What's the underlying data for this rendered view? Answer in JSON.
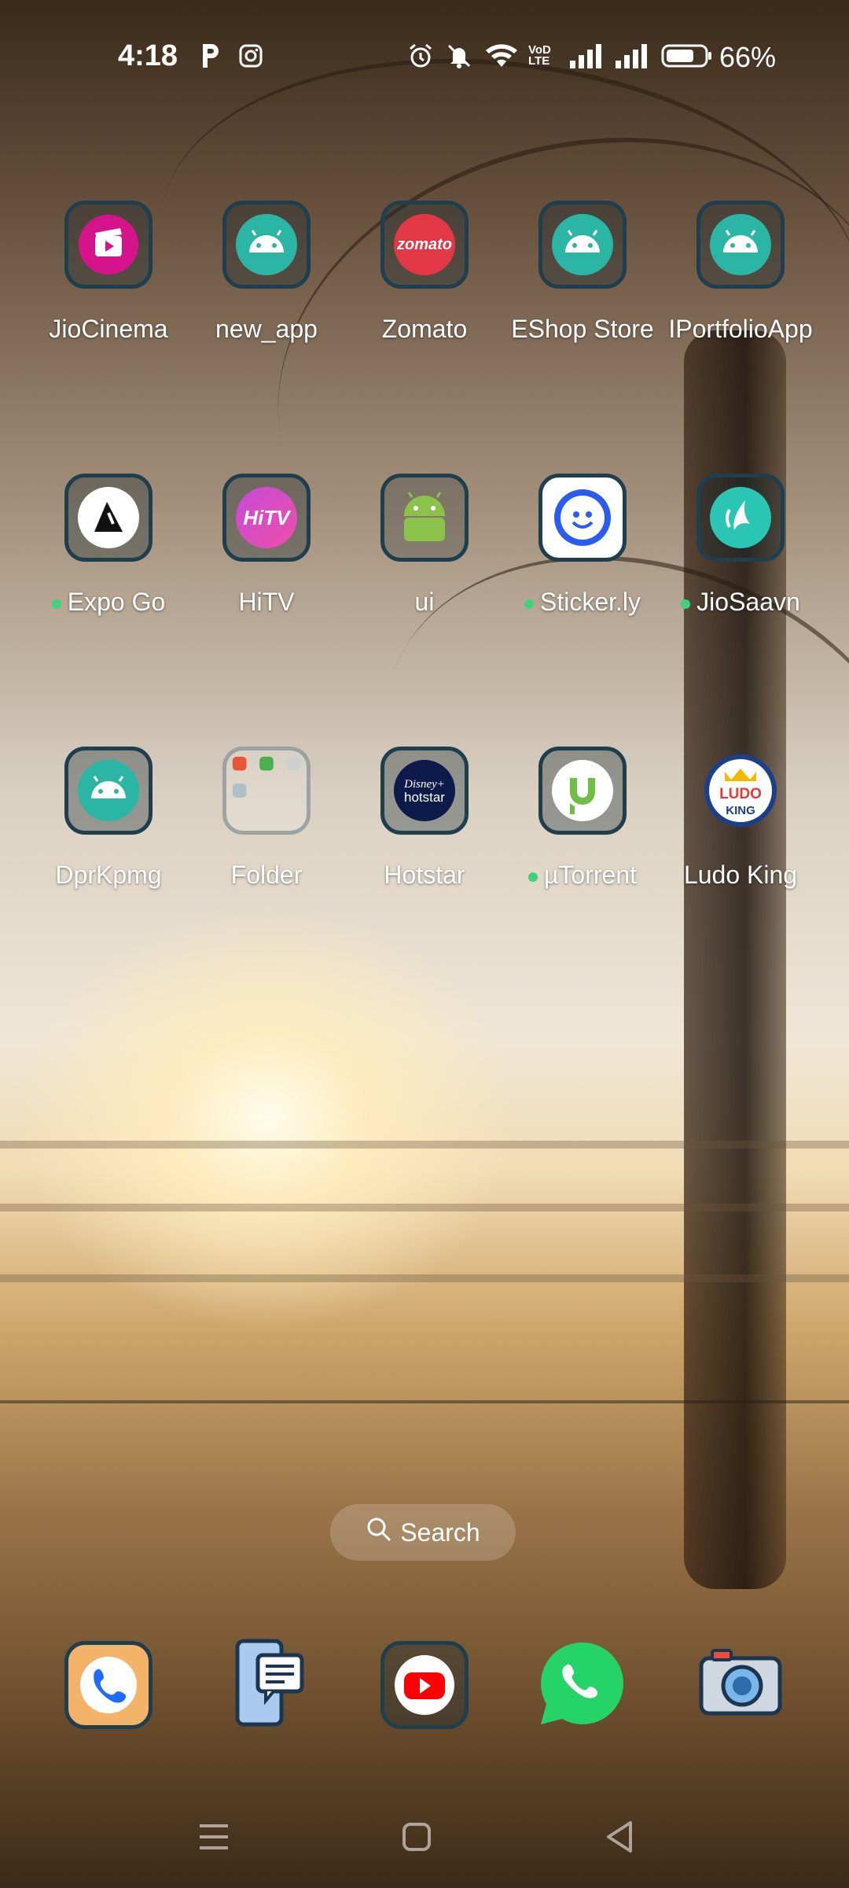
{
  "status_bar": {
    "time": "4:18",
    "battery_percent": "66%",
    "network_label": "VoD LTE",
    "icons": [
      "p-notification-icon",
      "instagram-icon",
      "alarm-icon",
      "mute-icon",
      "wifi-icon",
      "volte-icon",
      "signal-icon",
      "signal-icon",
      "battery-icon"
    ]
  },
  "apps": [
    {
      "label": "JioCinema",
      "icon": "jiocinema-icon",
      "dot": false
    },
    {
      "label": "new_app",
      "icon": "android-icon",
      "dot": false
    },
    {
      "label": "Zomato",
      "icon": "zomato-icon",
      "dot": false
    },
    {
      "label": "EShop Store",
      "icon": "android-icon",
      "dot": false
    },
    {
      "label": "IPortfolioApp",
      "icon": "android-icon",
      "dot": false
    },
    {
      "label": "Expo Go",
      "icon": "expo-go-icon",
      "dot": true
    },
    {
      "label": "HiTV",
      "icon": "hitv-icon",
      "dot": false
    },
    {
      "label": "ui",
      "icon": "android-green-icon",
      "dot": false
    },
    {
      "label": "Sticker.ly",
      "icon": "stickerly-icon",
      "dot": true
    },
    {
      "label": "JioSaavn",
      "icon": "jiosaavn-icon",
      "dot": true
    },
    {
      "label": "DprKpmg",
      "icon": "android-icon",
      "dot": false
    },
    {
      "label": "Folder",
      "icon": "folder-icon",
      "dot": false
    },
    {
      "label": "Hotstar",
      "icon": "hotstar-icon",
      "dot": false
    },
    {
      "label": "µTorrent",
      "icon": "utorrent-icon",
      "dot": true
    },
    {
      "label": "Ludo King",
      "icon": "ludo-king-icon",
      "dot": false
    }
  ],
  "icon_text": {
    "zomato": "zomato",
    "hitv": "HiTV",
    "hotstar_top": "Disney+",
    "hotstar_bottom": "hotstar",
    "ludo": "LUDO",
    "ludo_king": "KING"
  },
  "search": {
    "label": "Search"
  },
  "dock": [
    {
      "icon": "phone-icon"
    },
    {
      "icon": "messages-icon"
    },
    {
      "icon": "youtube-icon"
    },
    {
      "icon": "whatsapp-icon"
    },
    {
      "icon": "camera-icon"
    }
  ],
  "colors": {
    "tile_border": "#1f3f4f",
    "android_teal": "#2bb5a4",
    "status_dot": "#3fd27a"
  }
}
